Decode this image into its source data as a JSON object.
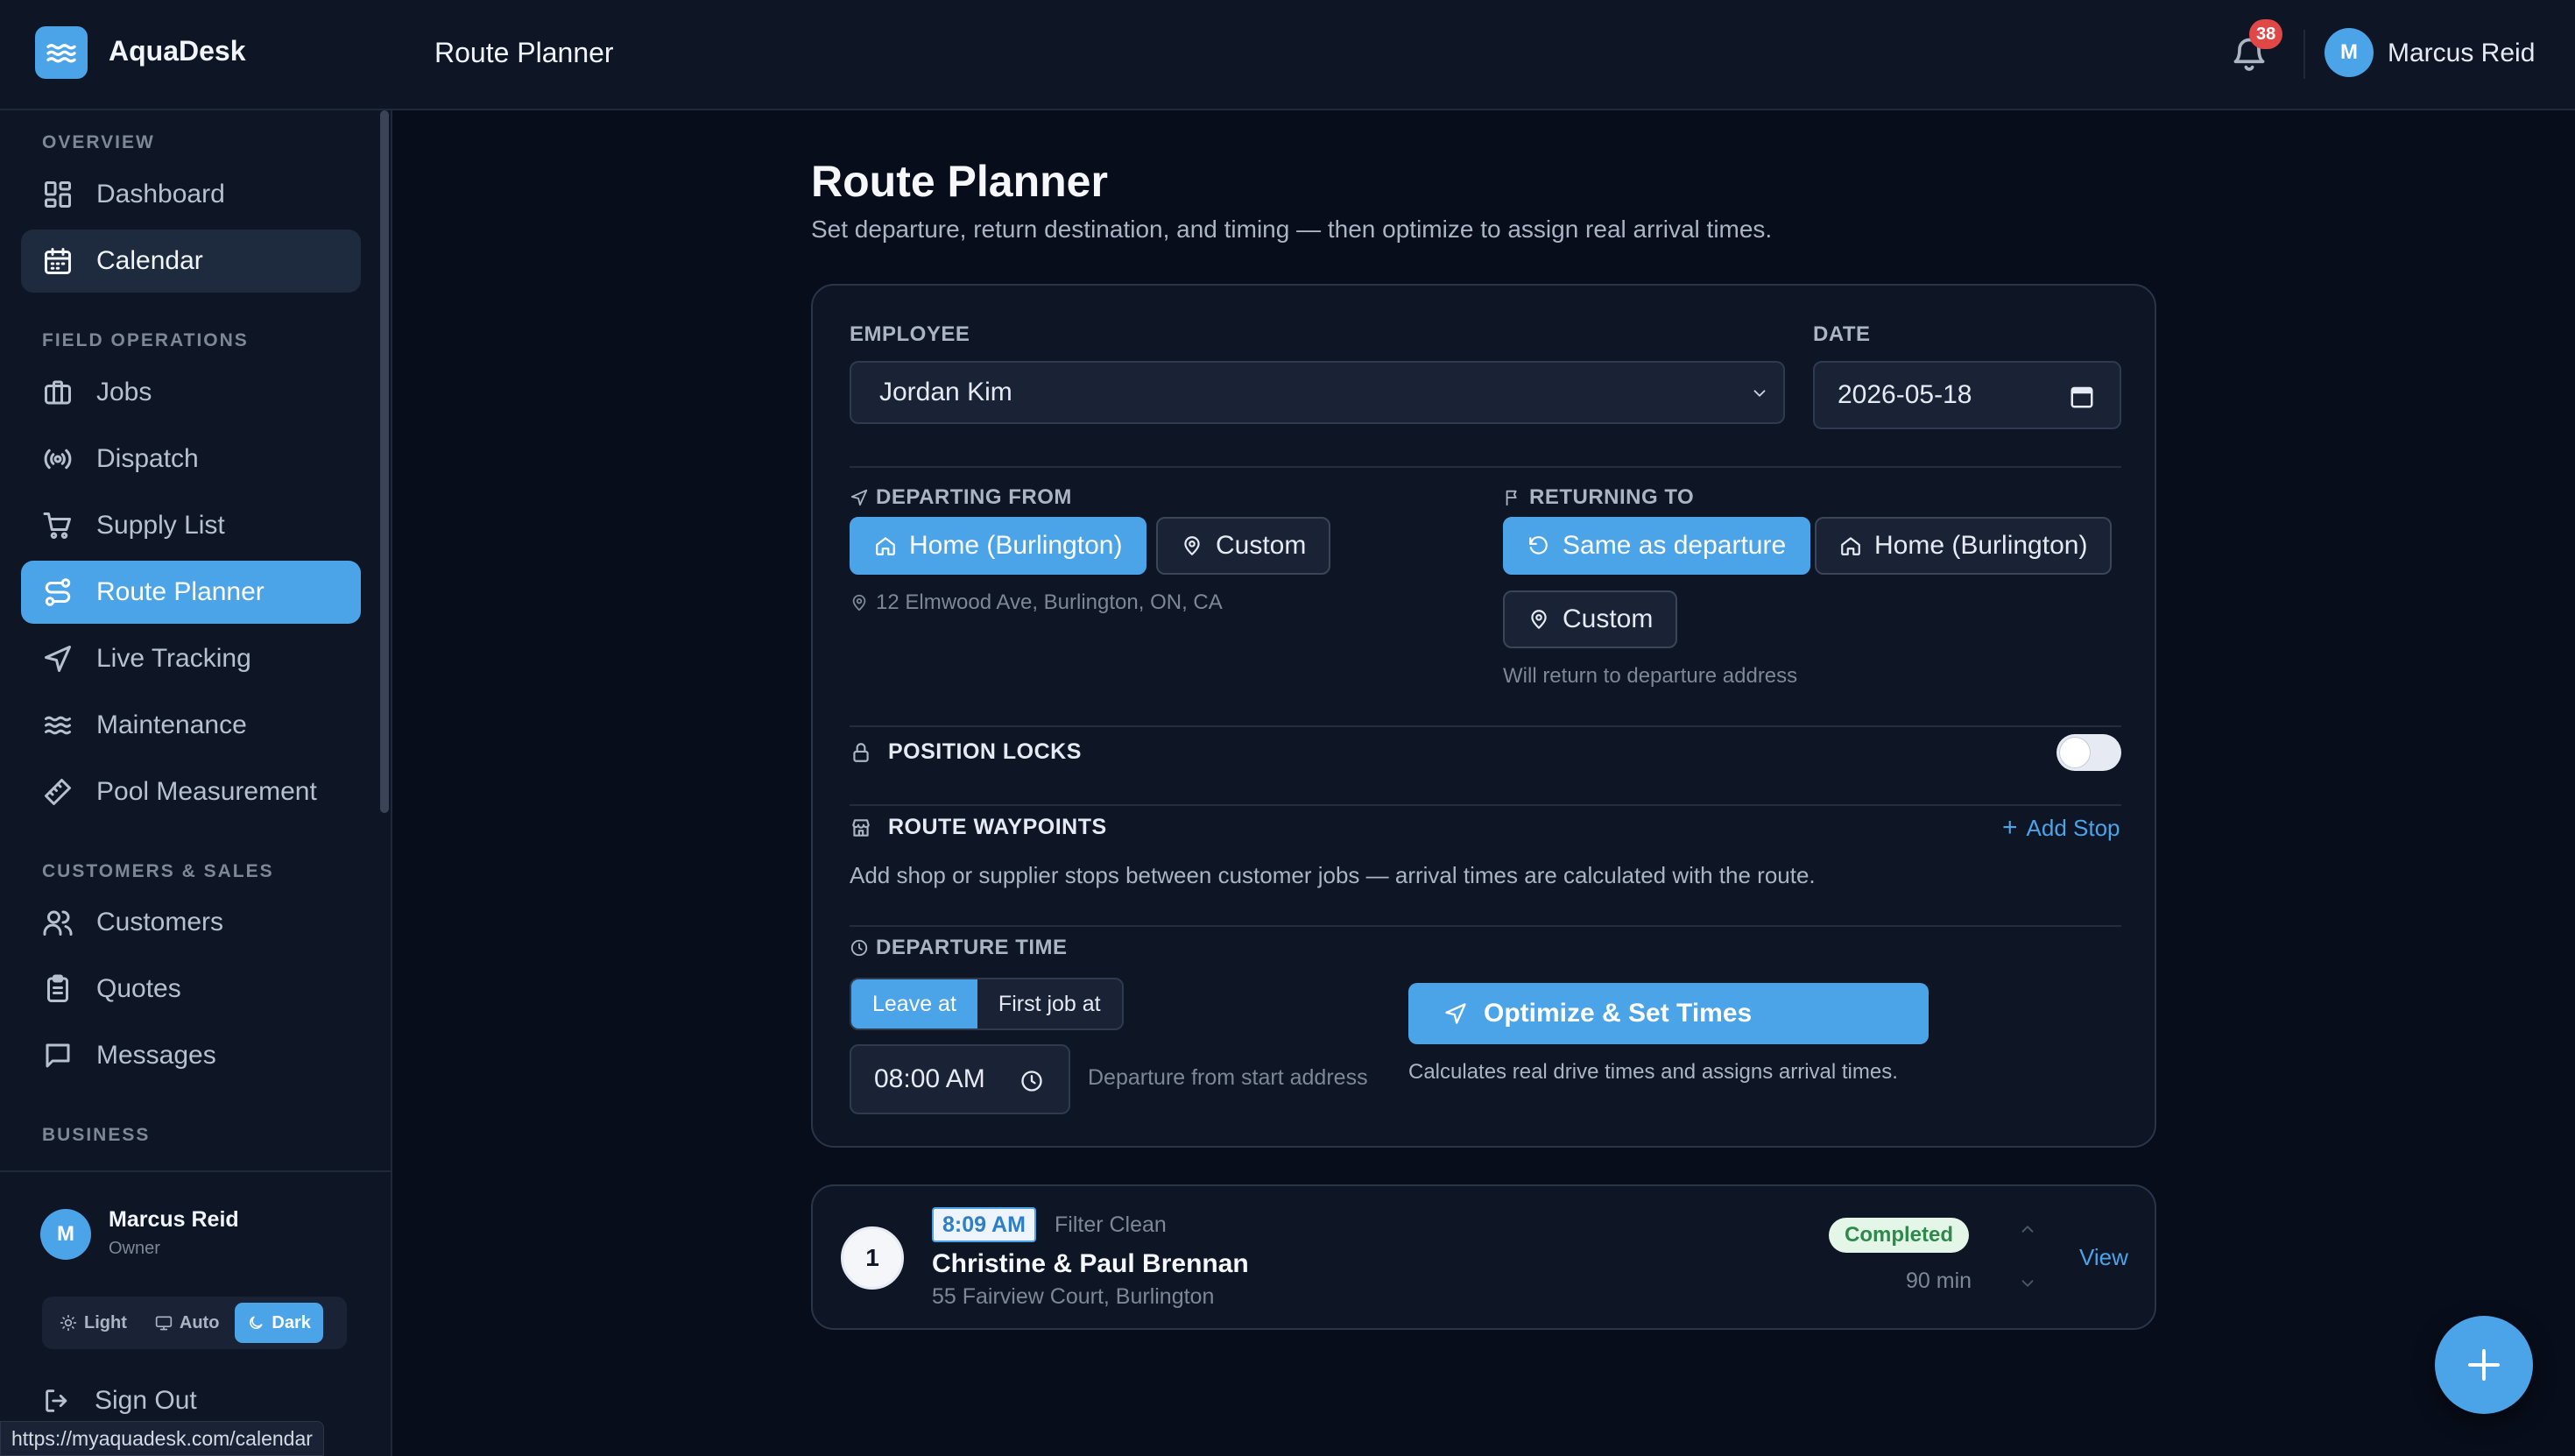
{
  "app": {
    "name": "AquaDesk",
    "page_title": "Route Planner"
  },
  "header": {
    "notification_count": "38",
    "user_initial": "M",
    "user_name": "Marcus Reid"
  },
  "sidebar": {
    "sections": {
      "overview": "OVERVIEW",
      "field": "FIELD OPERATIONS",
      "customers": "CUSTOMERS & SALES",
      "business": "BUSINESS"
    },
    "items": {
      "dashboard": "Dashboard",
      "calendar": "Calendar",
      "jobs": "Jobs",
      "dispatch": "Dispatch",
      "supply": "Supply List",
      "route": "Route Planner",
      "tracking": "Live Tracking",
      "maintenance": "Maintenance",
      "pool": "Pool Measurement",
      "customers": "Customers",
      "quotes": "Quotes",
      "messages": "Messages"
    },
    "profile": {
      "initial": "M",
      "name": "Marcus Reid",
      "role": "Owner"
    },
    "theme": {
      "light": "Light",
      "auto": "Auto",
      "dark": "Dark",
      "selected": "Dark"
    },
    "sign_out": "Sign Out"
  },
  "status_url": "https://myaquadesk.com/calendar",
  "main": {
    "title": "Route Planner",
    "subtitle": "Set departure, return destination, and timing — then optimize to assign real arrival times.",
    "employee_label": "EMPLOYEE",
    "employee_value": "Jordan Kim",
    "date_label": "DATE",
    "date_value": "2026-05-18",
    "departing_label": "DEPARTING FROM",
    "departing_options": {
      "home": "Home (Burlington)",
      "custom": "Custom"
    },
    "departing_address": "12 Elmwood Ave, Burlington, ON, CA",
    "returning_label": "RETURNING TO",
    "returning_options": {
      "same": "Same as departure",
      "home": "Home (Burlington)",
      "custom": "Custom"
    },
    "returning_hint": "Will return to departure address",
    "position_locks_label": "POSITION LOCKS",
    "position_locks_on": false,
    "waypoints_label": "ROUTE WAYPOINTS",
    "add_stop": "Add Stop",
    "waypoints_text": "Add shop or supplier stops between customer jobs — arrival times are calculated with the route.",
    "departure_time_label": "DEPARTURE TIME",
    "departure_modes": {
      "leave": "Leave at",
      "first": "First job at"
    },
    "departure_time": "08:00 AM",
    "departure_hint": "Departure from start address",
    "optimize_button": "Optimize & Set Times",
    "optimize_note": "Calculates real drive times and assigns arrival times."
  },
  "stops": [
    {
      "number": "1",
      "time": "8:09 AM",
      "type": "Filter Clean",
      "name": "Christine & Paul Brennan",
      "address": "55 Fairview Court, Burlington",
      "status": "Completed",
      "duration": "90 min",
      "action": "View"
    }
  ],
  "colors": {
    "accent": "#4ba3e8",
    "background": "#070d1a",
    "surface": "#0e1626",
    "badge": "#e04848",
    "success": "#2e8a4a"
  }
}
